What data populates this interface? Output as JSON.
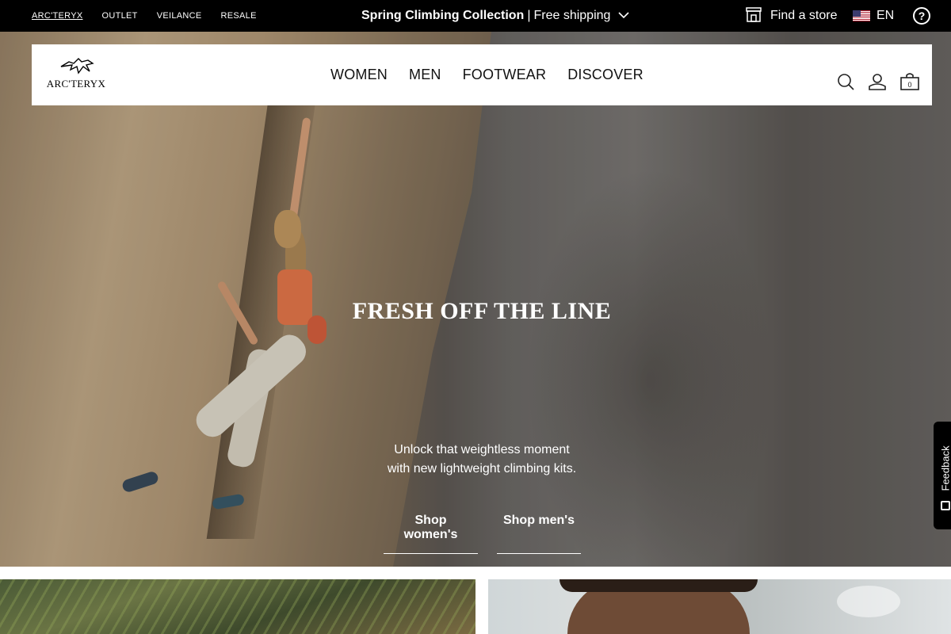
{
  "topbar": {
    "brands": [
      {
        "label": "ARC'TERYX",
        "active": true
      },
      {
        "label": "OUTLET",
        "active": false
      },
      {
        "label": "VEILANCE",
        "active": false
      },
      {
        "label": "RESALE",
        "active": false
      }
    ],
    "promo": {
      "title": "Spring Climbing Collection",
      "separator": "|",
      "detail": "Free shipping"
    },
    "store_label": "Find a store",
    "language": "EN",
    "help_symbol": "?"
  },
  "nav": {
    "logo_text": "ARC'TERYX",
    "menu": [
      "WOMEN",
      "MEN",
      "FOOTWEAR",
      "DISCOVER"
    ],
    "cart_count": "0"
  },
  "hero": {
    "title": "FRESH OFF THE LINE",
    "subtitle_line1": "Unlock that weightless moment",
    "subtitle_line2": "with new lightweight climbing kits.",
    "cta_women": "Shop women's",
    "cta_men": "Shop men's"
  },
  "feedback": {
    "label": "Feedback"
  },
  "colors": {
    "topbar_bg": "#000000",
    "nav_bg": "#ffffff",
    "text_dark": "#111111",
    "hero_text": "#ffffff"
  },
  "icons": [
    "store-icon",
    "us-flag-icon",
    "help-icon",
    "chevron-down-icon",
    "search-icon",
    "account-icon",
    "cart-icon",
    "feedback-icon"
  ]
}
